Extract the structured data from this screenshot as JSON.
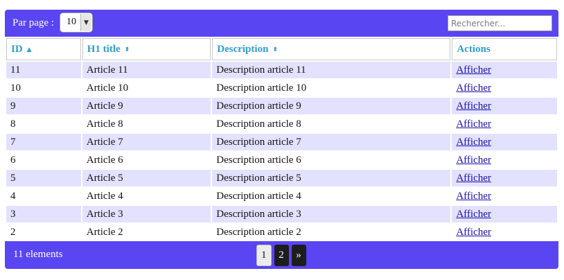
{
  "toolbar": {
    "perpage_label": "Par page :",
    "perpage_value": "10",
    "search_placeholder": "Rechercher..."
  },
  "table": {
    "columns": [
      "ID",
      "H1 title",
      "Description",
      "Actions"
    ],
    "sort_icons": [
      "sort-asc-icon",
      "sort-icon",
      "sort-icon"
    ],
    "rows": [
      {
        "id": "11",
        "title": "Article 11",
        "description": "Description article 11",
        "action": "Afficher"
      },
      {
        "id": "10",
        "title": "Article 10",
        "description": "Description article 10",
        "action": "Afficher"
      },
      {
        "id": "9",
        "title": "Article 9",
        "description": "Description article 9",
        "action": "Afficher"
      },
      {
        "id": "8",
        "title": "Article 8",
        "description": "Description article 8",
        "action": "Afficher"
      },
      {
        "id": "7",
        "title": "Article 7",
        "description": "Description article 7",
        "action": "Afficher"
      },
      {
        "id": "6",
        "title": "Article 6",
        "description": "Description article 6",
        "action": "Afficher"
      },
      {
        "id": "5",
        "title": "Article 5",
        "description": "Description article 5",
        "action": "Afficher"
      },
      {
        "id": "4",
        "title": "Article 4",
        "description": "Description article 4",
        "action": "Afficher"
      },
      {
        "id": "3",
        "title": "Article 3",
        "description": "Description article 3",
        "action": "Afficher"
      },
      {
        "id": "2",
        "title": "Article 2",
        "description": "Description article 2",
        "action": "Afficher"
      }
    ]
  },
  "footer": {
    "count_label": "11 elements",
    "pages": [
      "1",
      "2"
    ],
    "next_label": "»"
  },
  "colors": {
    "bar": "#5945f2",
    "header_text": "#2f9ecf",
    "row_stripe": "#e2e2ff",
    "link": "#1a0dab"
  }
}
